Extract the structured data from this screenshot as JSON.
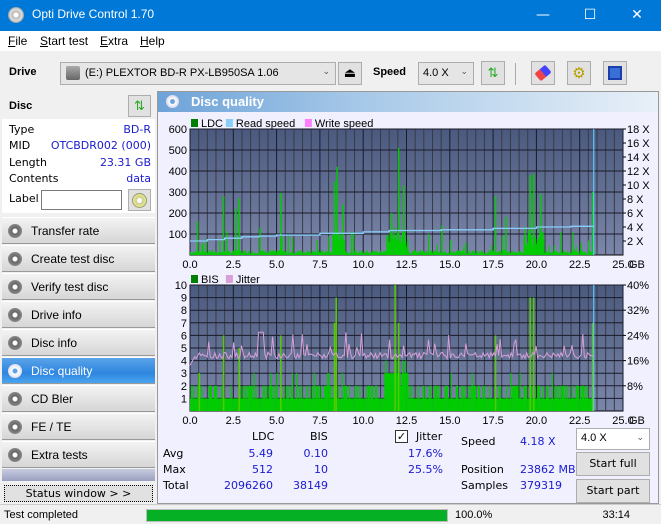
{
  "window": {
    "title": "Opti Drive Control 1.70",
    "minimize": "—",
    "maximize": "☐",
    "close": "✕"
  },
  "menu": [
    {
      "label": "File",
      "accel": "F",
      "rest": "ile"
    },
    {
      "label": "Start test",
      "accel": "S",
      "rest": "tart test"
    },
    {
      "label": "Extra",
      "accel": "E",
      "rest": "xtra"
    },
    {
      "label": "Help",
      "accel": "H",
      "rest": "elp"
    }
  ],
  "toolbar": {
    "drive_label": "Drive",
    "drive_value": "(E:)  PLEXTOR BD-R  PX-LB950SA 1.06",
    "speed_label": "Speed",
    "speed_value": "4.0 X"
  },
  "disc": {
    "header": "Disc",
    "rows": [
      {
        "key": "Type",
        "value": "BD-R"
      },
      {
        "key": "MID",
        "value": "OTCBDR002 (000)"
      },
      {
        "key": "Length",
        "value": "23.31 GB"
      },
      {
        "key": "Contents",
        "value": "data"
      }
    ],
    "label_key": "Label",
    "label_value": ""
  },
  "nav": [
    {
      "label": "Transfer rate",
      "active": false
    },
    {
      "label": "Create test disc",
      "active": false
    },
    {
      "label": "Verify test disc",
      "active": false
    },
    {
      "label": "Drive info",
      "active": false
    },
    {
      "label": "Disc info",
      "active": false
    },
    {
      "label": "Disc quality",
      "active": true
    },
    {
      "label": "CD Bler",
      "active": false
    },
    {
      "label": "FE / TE",
      "active": false
    },
    {
      "label": "Extra tests",
      "active": false
    }
  ],
  "status_window_label": "Status window > >",
  "panel_title": "Disc quality",
  "chart_data": [
    {
      "type": "bar",
      "title": "LDC / Read speed",
      "legend": [
        "LDC",
        "Read speed",
        "Write speed"
      ],
      "legend_colors": [
        "#008000",
        "#87cefa",
        "#ff80ff"
      ],
      "xlabel": "GB",
      "xlim": [
        0,
        25
      ],
      "x_ticks": [
        "0.0",
        "2.5",
        "5.0",
        "7.5",
        "10.0",
        "12.5",
        "15.0",
        "17.5",
        "20.0",
        "22.5",
        "25.0"
      ],
      "ylim_left": [
        0,
        600
      ],
      "y_ticks_left": [
        "100",
        "200",
        "300",
        "400",
        "500",
        "600"
      ],
      "ylim_right": [
        0,
        18
      ],
      "y_ticks_right": [
        "2 X",
        "4 X",
        "6 X",
        "8 X",
        "10 X",
        "12 X",
        "14 X",
        "16 X",
        "18 X"
      ],
      "ldc_peaks": [
        {
          "x": 0.4,
          "y": 160
        },
        {
          "x": 1.9,
          "y": 280
        },
        {
          "x": 2.6,
          "y": 220
        },
        {
          "x": 2.8,
          "y": 270
        },
        {
          "x": 4.0,
          "y": 130
        },
        {
          "x": 5.2,
          "y": 295
        },
        {
          "x": 8.3,
          "y": 350
        },
        {
          "x": 8.45,
          "y": 420
        },
        {
          "x": 8.8,
          "y": 240
        },
        {
          "x": 11.6,
          "y": 200
        },
        {
          "x": 12.0,
          "y": 510
        },
        {
          "x": 12.3,
          "y": 330
        },
        {
          "x": 14.5,
          "y": 140
        },
        {
          "x": 17.6,
          "y": 280
        },
        {
          "x": 18.2,
          "y": 180
        },
        {
          "x": 19.6,
          "y": 380
        },
        {
          "x": 19.8,
          "y": 385
        },
        {
          "x": 20.2,
          "y": 290
        },
        {
          "x": 23.2,
          "y": 300
        }
      ],
      "ldc_baseline": 20,
      "read_speed": [
        {
          "x": 0.0,
          "y": 2.0
        },
        {
          "x": 1.0,
          "y": 2.2
        },
        {
          "x": 2.0,
          "y": 2.4
        },
        {
          "x": 3.0,
          "y": 2.6
        },
        {
          "x": 4.0,
          "y": 2.7
        },
        {
          "x": 5.0,
          "y": 2.85
        },
        {
          "x": 7.5,
          "y": 3.1
        },
        {
          "x": 10.0,
          "y": 3.3
        },
        {
          "x": 11.5,
          "y": 3.5
        },
        {
          "x": 14.5,
          "y": 3.6
        },
        {
          "x": 17.5,
          "y": 3.8
        },
        {
          "x": 20.0,
          "y": 4.0
        },
        {
          "x": 22.0,
          "y": 4.1
        },
        {
          "x": 23.31,
          "y": 4.18
        }
      ],
      "end_marker_x": 23.31
    },
    {
      "type": "bar",
      "title": "BIS / Jitter",
      "legend": [
        "BIS",
        "Jitter"
      ],
      "legend_colors": [
        "#008000",
        "#d8a0d8"
      ],
      "xlabel": "GB",
      "xlim": [
        0,
        25
      ],
      "x_ticks": [
        "0.0",
        "2.5",
        "5.0",
        "7.5",
        "10.0",
        "12.5",
        "15.0",
        "17.5",
        "20.0",
        "22.5",
        "25.0"
      ],
      "ylim_left": [
        0,
        10
      ],
      "y_ticks_left": [
        "1",
        "2",
        "3",
        "4",
        "5",
        "6",
        "7",
        "8",
        "9",
        "10"
      ],
      "ylim_right": [
        0,
        40
      ],
      "y_ticks_right": [
        "8%",
        "16%",
        "24%",
        "32%",
        "40%"
      ],
      "bis_peaks": [
        {
          "x": 0.5,
          "y": 3
        },
        {
          "x": 1.9,
          "y": 6
        },
        {
          "x": 2.8,
          "y": 5
        },
        {
          "x": 5.2,
          "y": 6
        },
        {
          "x": 8.3,
          "y": 7
        },
        {
          "x": 8.4,
          "y": 9
        },
        {
          "x": 11.8,
          "y": 10
        },
        {
          "x": 12.0,
          "y": 7
        },
        {
          "x": 17.6,
          "y": 6
        },
        {
          "x": 19.6,
          "y": 9
        },
        {
          "x": 19.8,
          "y": 9
        },
        {
          "x": 23.2,
          "y": 7
        }
      ],
      "jitter_avg_pct": 17.6,
      "jitter_max_pct": 25.5,
      "end_marker_x": 23.31
    }
  ],
  "stats": {
    "col_ldc": "LDC",
    "col_bis": "BIS",
    "jitter_label": "Jitter",
    "jitter_checked": true,
    "rows": [
      {
        "label": "Avg",
        "ldc": "5.49",
        "bis": "0.10",
        "jitter": "17.6%"
      },
      {
        "label": "Max",
        "ldc": "512",
        "bis": "10",
        "jitter": "25.5%"
      },
      {
        "label": "Total",
        "ldc": "2096260",
        "bis": "38149",
        "jitter": ""
      }
    ],
    "speed_label": "Speed",
    "speed_value": "4.18 X",
    "position_label": "Position",
    "position_value": "23862 MB",
    "samples_label": "Samples",
    "samples_value": "379319",
    "speed_select": "4.0 X",
    "start_full": "Start full",
    "start_part": "Start part"
  },
  "statusbar": {
    "message": "Test completed",
    "progress": 100.0,
    "progress_text": "100.0%",
    "time": "33:14"
  }
}
